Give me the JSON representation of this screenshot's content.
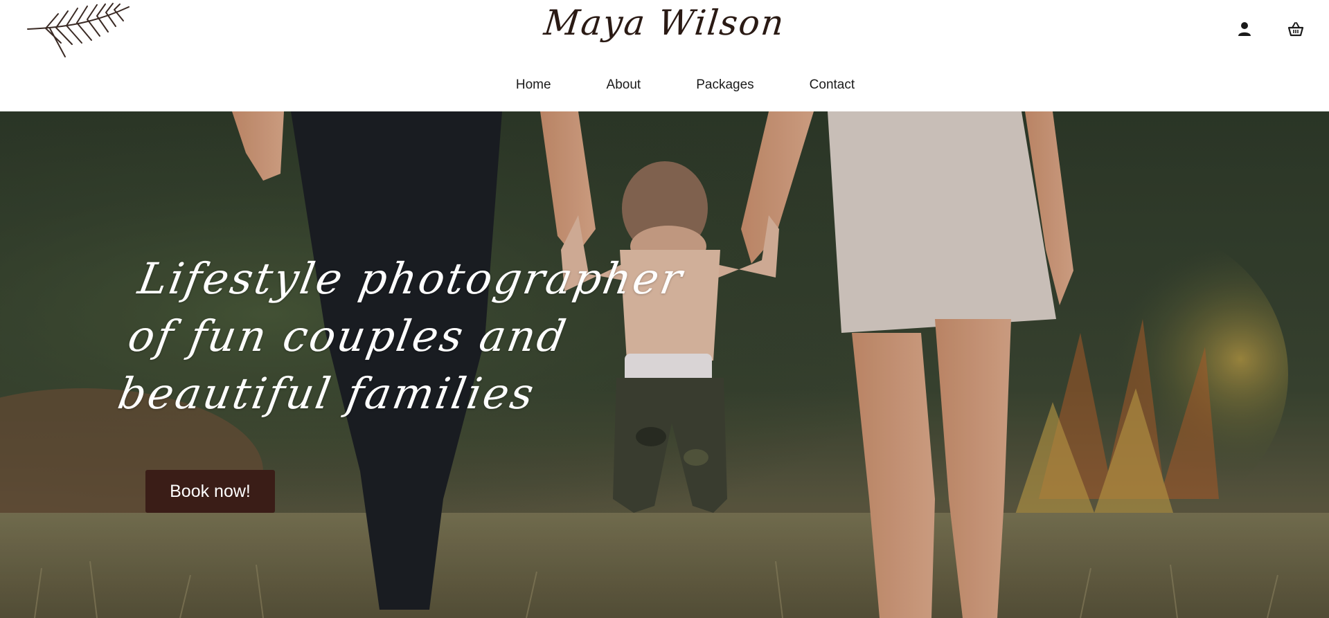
{
  "header": {
    "brand": "Maya Wilson",
    "icons": [
      "leaf-logo-icon",
      "user-icon",
      "basket-icon"
    ]
  },
  "nav": {
    "items": [
      {
        "label": "Home"
      },
      {
        "label": "About"
      },
      {
        "label": "Packages"
      },
      {
        "label": "Contact"
      }
    ]
  },
  "hero": {
    "title_lines": [
      "Lifestyle photographer",
      "of fun couples and",
      "beautiful families"
    ],
    "cta_label": "Book now!"
  },
  "colors": {
    "brand_text": "#2a1a14",
    "button_bg": "#3a1d17",
    "hero_text": "#ffffff"
  }
}
